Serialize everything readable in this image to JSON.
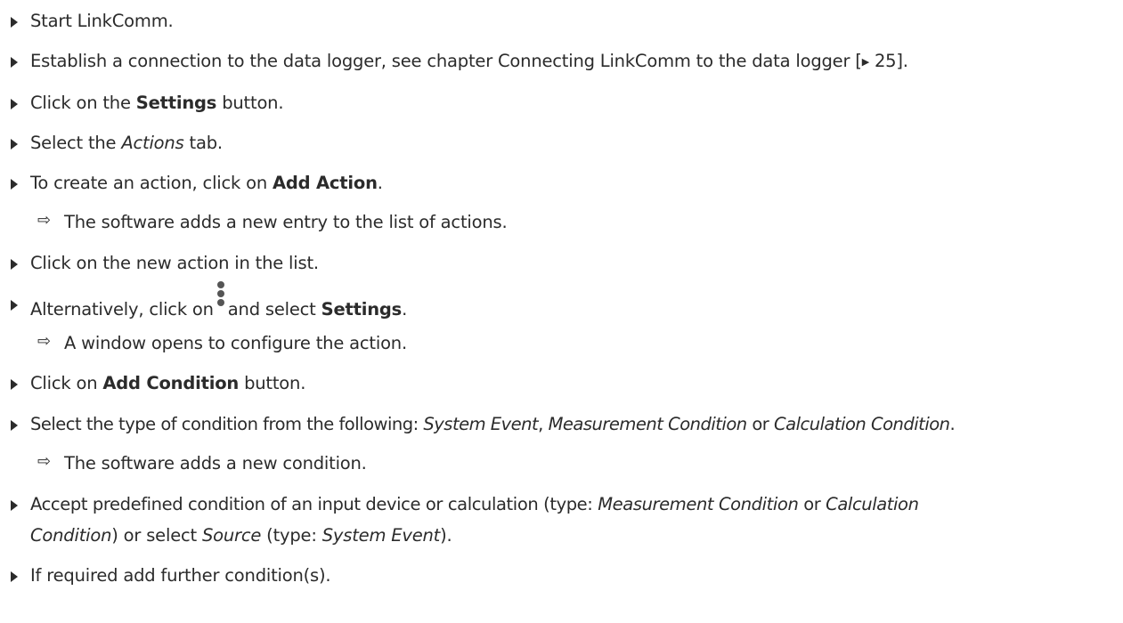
{
  "steps": {
    "s1": "Start LinkComm.",
    "s2": {
      "text": "Establish a connection to the data logger, see chapter Connecting LinkComm to the data logger [",
      "page_ref": "25",
      "close": "]."
    },
    "s3": {
      "pre": "Click on the ",
      "bold": "Settings",
      "post": " button."
    },
    "s4": {
      "pre": "Select the ",
      "italic": "Actions",
      "post": " tab."
    },
    "s5": {
      "pre": "To create an action, click on ",
      "bold": "Add Action",
      "post": "."
    },
    "r1": "The software adds a new entry to the list of actions.",
    "s6": "Click on the new action in the list.",
    "s7": {
      "pre": "Alternatively, click on",
      "mid": "and select ",
      "bold": "Settings",
      "post": "."
    },
    "r2": "A window opens to configure the action.",
    "s8": {
      "pre": "Click on ",
      "bold": "Add Condition",
      "post": " button."
    },
    "s9": {
      "pre": "Select the type of condition from the following: ",
      "opt1": "System Event",
      "sep1": ", ",
      "opt2": "Measurement Condition",
      "sep2": " or ",
      "opt3": "Calculation Condition",
      "post": "."
    },
    "r3": "The software adds a new condition.",
    "s10": {
      "line1_pre": "Accept predefined condition of an input device or calculation (type: ",
      "line1_opt1": "Measurement Condition",
      "line1_sep": " or ",
      "line1_opt2": "Calculation",
      "line2_opt2": "Condition",
      "line2_mid": ") or select ",
      "line2_src": "Source",
      "line2_mid2": " (type: ",
      "line2_opt3": "System Event",
      "line2_post": ")."
    },
    "s11": "If required add further condition(s)."
  },
  "icons": {
    "bullet": "right-triangle-bullet-icon",
    "result": "result-arrow-icon",
    "kebab": "vertical-ellipsis-icon",
    "page_ref": "play-triangle-icon"
  },
  "symbols": {
    "result_arrow": "⇨",
    "ref_triangle": "▶"
  }
}
